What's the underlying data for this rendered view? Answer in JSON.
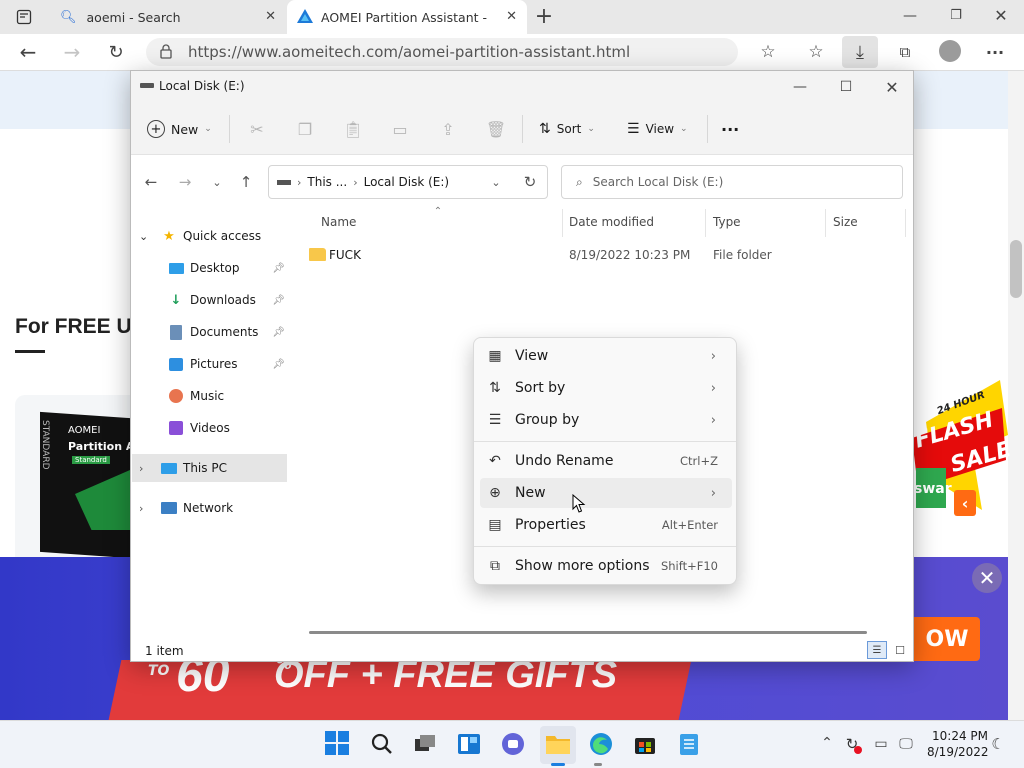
{
  "browser": {
    "tabs": [
      {
        "title": "aoemi - Search",
        "icon": "search-icon"
      },
      {
        "title": "AOMEI Partition Assistant - A Sa",
        "icon": "aomei-logo-icon"
      }
    ],
    "new_tab": "+",
    "url": "https://www.aomeitech.com/aomei-partition-assistant.html"
  },
  "site": {
    "free_use_heading": "For FREE Us",
    "product_brand": "AOMEI",
    "product_name": "Partition Assist",
    "product_edition": "Standard",
    "box_side": "STANDARD",
    "promo_text": "60",
    "promo_text2": "OFF + FREE GIFTS",
    "promo_prefix": "TO",
    "promo_suffix": "%",
    "flash_top": "24 HOUR",
    "flash_line1": "FLASH",
    "flash_line2": "SALE",
    "flash_partial": "swar",
    "buy_now_partial": "OW",
    "close_symbol": "✕"
  },
  "explorer": {
    "title": "Local Disk (E:)",
    "toolbar": {
      "new_label": "New",
      "sort_label": "Sort",
      "view_label": "View",
      "more_label": "···"
    },
    "breadcrumb": [
      "This ...",
      "Local Disk (E:)"
    ],
    "search_placeholder": "Search Local Disk (E:)",
    "nav_items": [
      {
        "label": "Quick access",
        "icon": "star-icon",
        "expanded": true
      },
      {
        "label": "Desktop",
        "icon": "desktop-icon",
        "pinned": true
      },
      {
        "label": "Downloads",
        "icon": "download-icon",
        "pinned": true
      },
      {
        "label": "Documents",
        "icon": "documents-icon",
        "pinned": true
      },
      {
        "label": "Pictures",
        "icon": "pictures-icon",
        "pinned": true
      },
      {
        "label": "Music",
        "icon": "music-icon"
      },
      {
        "label": "Videos",
        "icon": "videos-icon"
      },
      {
        "label": "This PC",
        "icon": "pc-icon",
        "selected": true
      },
      {
        "label": "Network",
        "icon": "network-icon"
      }
    ],
    "columns": [
      "Name",
      "Date modified",
      "Type",
      "Size"
    ],
    "files": [
      {
        "name": "FUCK",
        "date": "8/19/2022 10:23 PM",
        "type": "File folder",
        "size": ""
      }
    ],
    "status": "1 item"
  },
  "context_menu": {
    "items": [
      {
        "label": "View",
        "icon": "view-grid-icon",
        "submenu": true
      },
      {
        "label": "Sort by",
        "icon": "sort-icon",
        "submenu": true
      },
      {
        "label": "Group by",
        "icon": "group-icon",
        "submenu": true
      },
      {
        "label": "Undo Rename",
        "icon": "undo-icon",
        "shortcut": "Ctrl+Z"
      },
      {
        "label": "New",
        "icon": "new-plus-icon",
        "submenu": true
      },
      {
        "label": "Properties",
        "icon": "properties-icon",
        "shortcut": "Alt+Enter"
      },
      {
        "label": "Show more options",
        "icon": "more-options-icon",
        "shortcut": "Shift+F10"
      }
    ]
  },
  "taskbar": {
    "time": "10:24 PM",
    "date": "8/19/2022",
    "apps": [
      "start-icon",
      "search-icon",
      "task-view-icon",
      "widgets-icon",
      "teams-chat-icon",
      "file-explorer-icon",
      "edge-icon",
      "store-icon",
      "notepad-icon"
    ]
  }
}
